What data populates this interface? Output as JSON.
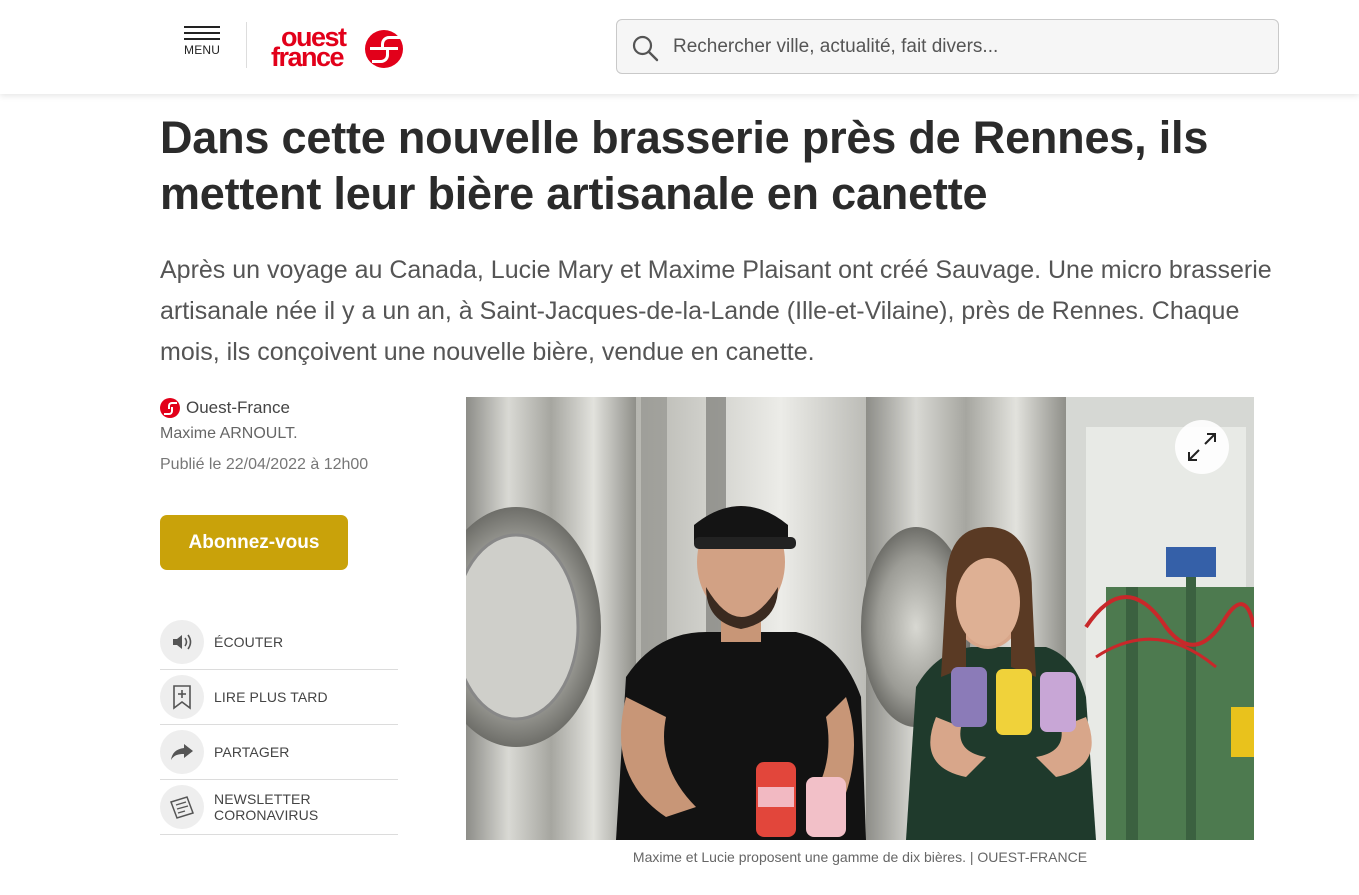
{
  "header": {
    "menu_label": "MENU",
    "logo_line1": "ouest",
    "logo_line2": "france",
    "search_placeholder": "Rechercher ville, actualité, fait divers..."
  },
  "article": {
    "title": "Dans cette nouvelle brasserie près de Rennes, ils mettent leur bière artisanale en canette",
    "lede": "Après un voyage au Canada, Lucie Mary et Maxime Plaisant ont créé Sauvage. Une micro brasserie artisanale née il y a un an, à Saint-Jacques-de-la-Lande (Ille-et-Vilaine), près de Rennes. Chaque mois, ils conçoivent une nouvelle bière, vendue en canette.",
    "source": "Ouest-France",
    "author": "Maxime ARNOULT.",
    "published": "Publié le 22/04/2022 à 12h00",
    "subscribe_label": "Abonnez-vous",
    "caption": "Maxime et Lucie proposent une gamme de dix bières. | OUEST-FRANCE"
  },
  "actions": [
    {
      "label": "ÉCOUTER",
      "icon": "speaker-icon"
    },
    {
      "label": "LIRE PLUS TARD",
      "icon": "bookmark-add-icon"
    },
    {
      "label": "PARTAGER",
      "icon": "share-arrow-icon"
    },
    {
      "label": "NEWSLETTER CORONAVIRUS",
      "icon": "newsletter-icon"
    }
  ],
  "colors": {
    "brand_red": "#e2001a",
    "subscribe_gold": "#c9a20a"
  }
}
